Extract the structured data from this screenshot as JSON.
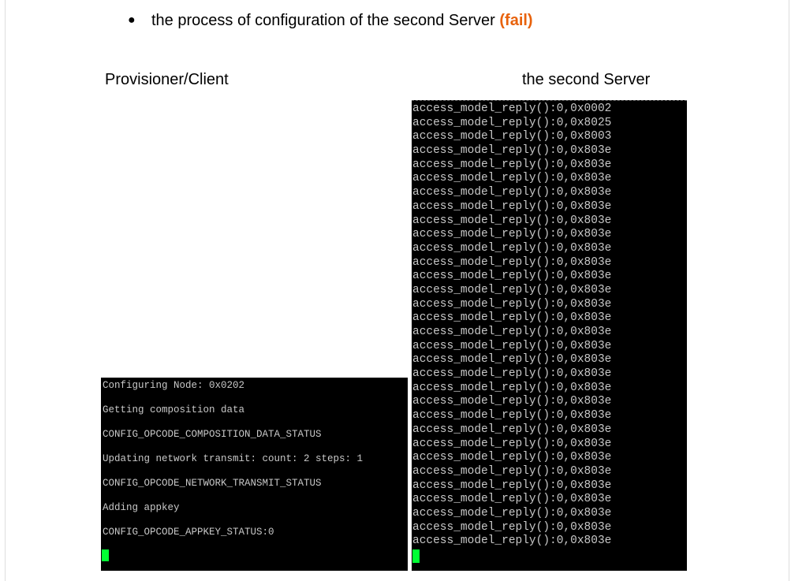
{
  "bullet": {
    "symbol": "●",
    "text": "the process of configuration of the second Server",
    "status": "(fail)"
  },
  "headings": {
    "left": "Provisioner/Client",
    "right": "the second Server"
  },
  "left_terminal": {
    "lines": [
      "Configuring Node: 0x0202",
      "Getting composition data",
      "CONFIG_OPCODE_COMPOSITION_DATA_STATUS",
      "Updating network transmit: count: 2 steps: 1",
      "CONFIG_OPCODE_NETWORK_TRANSMIT_STATUS",
      "Adding appkey",
      "CONFIG_OPCODE_APPKEY_STATUS:0"
    ],
    "cursor_color": "#00ff33"
  },
  "right_terminal": {
    "lines": [
      "access_model_reply():0,0x0002",
      "access_model_reply():0,0x8025",
      "access_model_reply():0,0x8003",
      "access_model_reply():0,0x803e",
      "access_model_reply():0,0x803e",
      "access_model_reply():0,0x803e",
      "access_model_reply():0,0x803e",
      "access_model_reply():0,0x803e",
      "access_model_reply():0,0x803e",
      "access_model_reply():0,0x803e",
      "access_model_reply():0,0x803e",
      "access_model_reply():0,0x803e",
      "access_model_reply():0,0x803e",
      "access_model_reply():0,0x803e",
      "access_model_reply():0,0x803e",
      "access_model_reply():0,0x803e",
      "access_model_reply():0,0x803e",
      "access_model_reply():0,0x803e",
      "access_model_reply():0,0x803e",
      "access_model_reply():0,0x803e",
      "access_model_reply():0,0x803e",
      "access_model_reply():0,0x803e",
      "access_model_reply():0,0x803e",
      "access_model_reply():0,0x803e",
      "access_model_reply():0,0x803e",
      "access_model_reply():0,0x803e",
      "access_model_reply():0,0x803e",
      "access_model_reply():0,0x803e",
      "access_model_reply():0,0x803e",
      "access_model_reply():0,0x803e",
      "access_model_reply():0,0x803e",
      "access_model_reply():0,0x803e"
    ],
    "cursor_color": "#00ff33"
  }
}
